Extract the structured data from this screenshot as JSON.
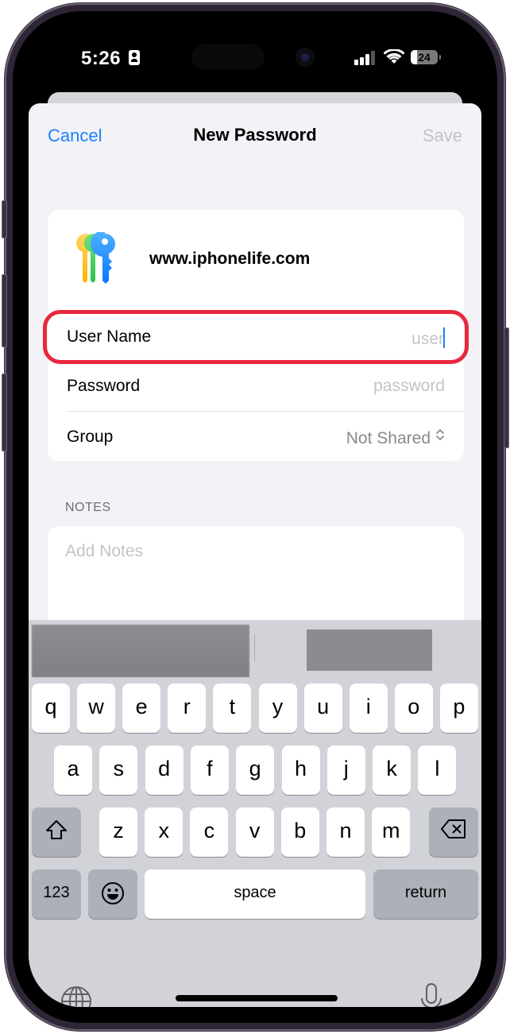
{
  "status_bar": {
    "time": "5:26",
    "battery_percent": 24,
    "battery_label": "24",
    "signal_bars_active": 3,
    "signal_bars_total": 4
  },
  "nav": {
    "cancel_label": "Cancel",
    "title": "New Password",
    "save_label": "Save",
    "save_enabled": false
  },
  "credential": {
    "website": "www.iphonelife.com",
    "fields": [
      {
        "label": "User Name",
        "placeholder": "user",
        "value": "",
        "focused": true,
        "highlighted": true
      },
      {
        "label": "Password",
        "placeholder": "password",
        "value": ""
      },
      {
        "label": "Group",
        "value": "Not Shared",
        "control": "chevron-up-down"
      }
    ]
  },
  "notes": {
    "header": "NOTES",
    "placeholder": "Add Notes"
  },
  "keyboard": {
    "row1": [
      "q",
      "w",
      "e",
      "r",
      "t",
      "y",
      "u",
      "i",
      "o",
      "p"
    ],
    "row2": [
      "a",
      "s",
      "d",
      "f",
      "g",
      "h",
      "j",
      "k",
      "l"
    ],
    "row3": [
      "z",
      "x",
      "c",
      "v",
      "b",
      "n",
      "m"
    ],
    "numbers_label": "123",
    "space_label": "space",
    "return_label": "return",
    "suggestions": [
      "(blurred)",
      "(blurred)"
    ]
  },
  "colors": {
    "accent": "#1a82fb",
    "highlight": "#e8283f",
    "disabled": "#c2c2c6"
  }
}
